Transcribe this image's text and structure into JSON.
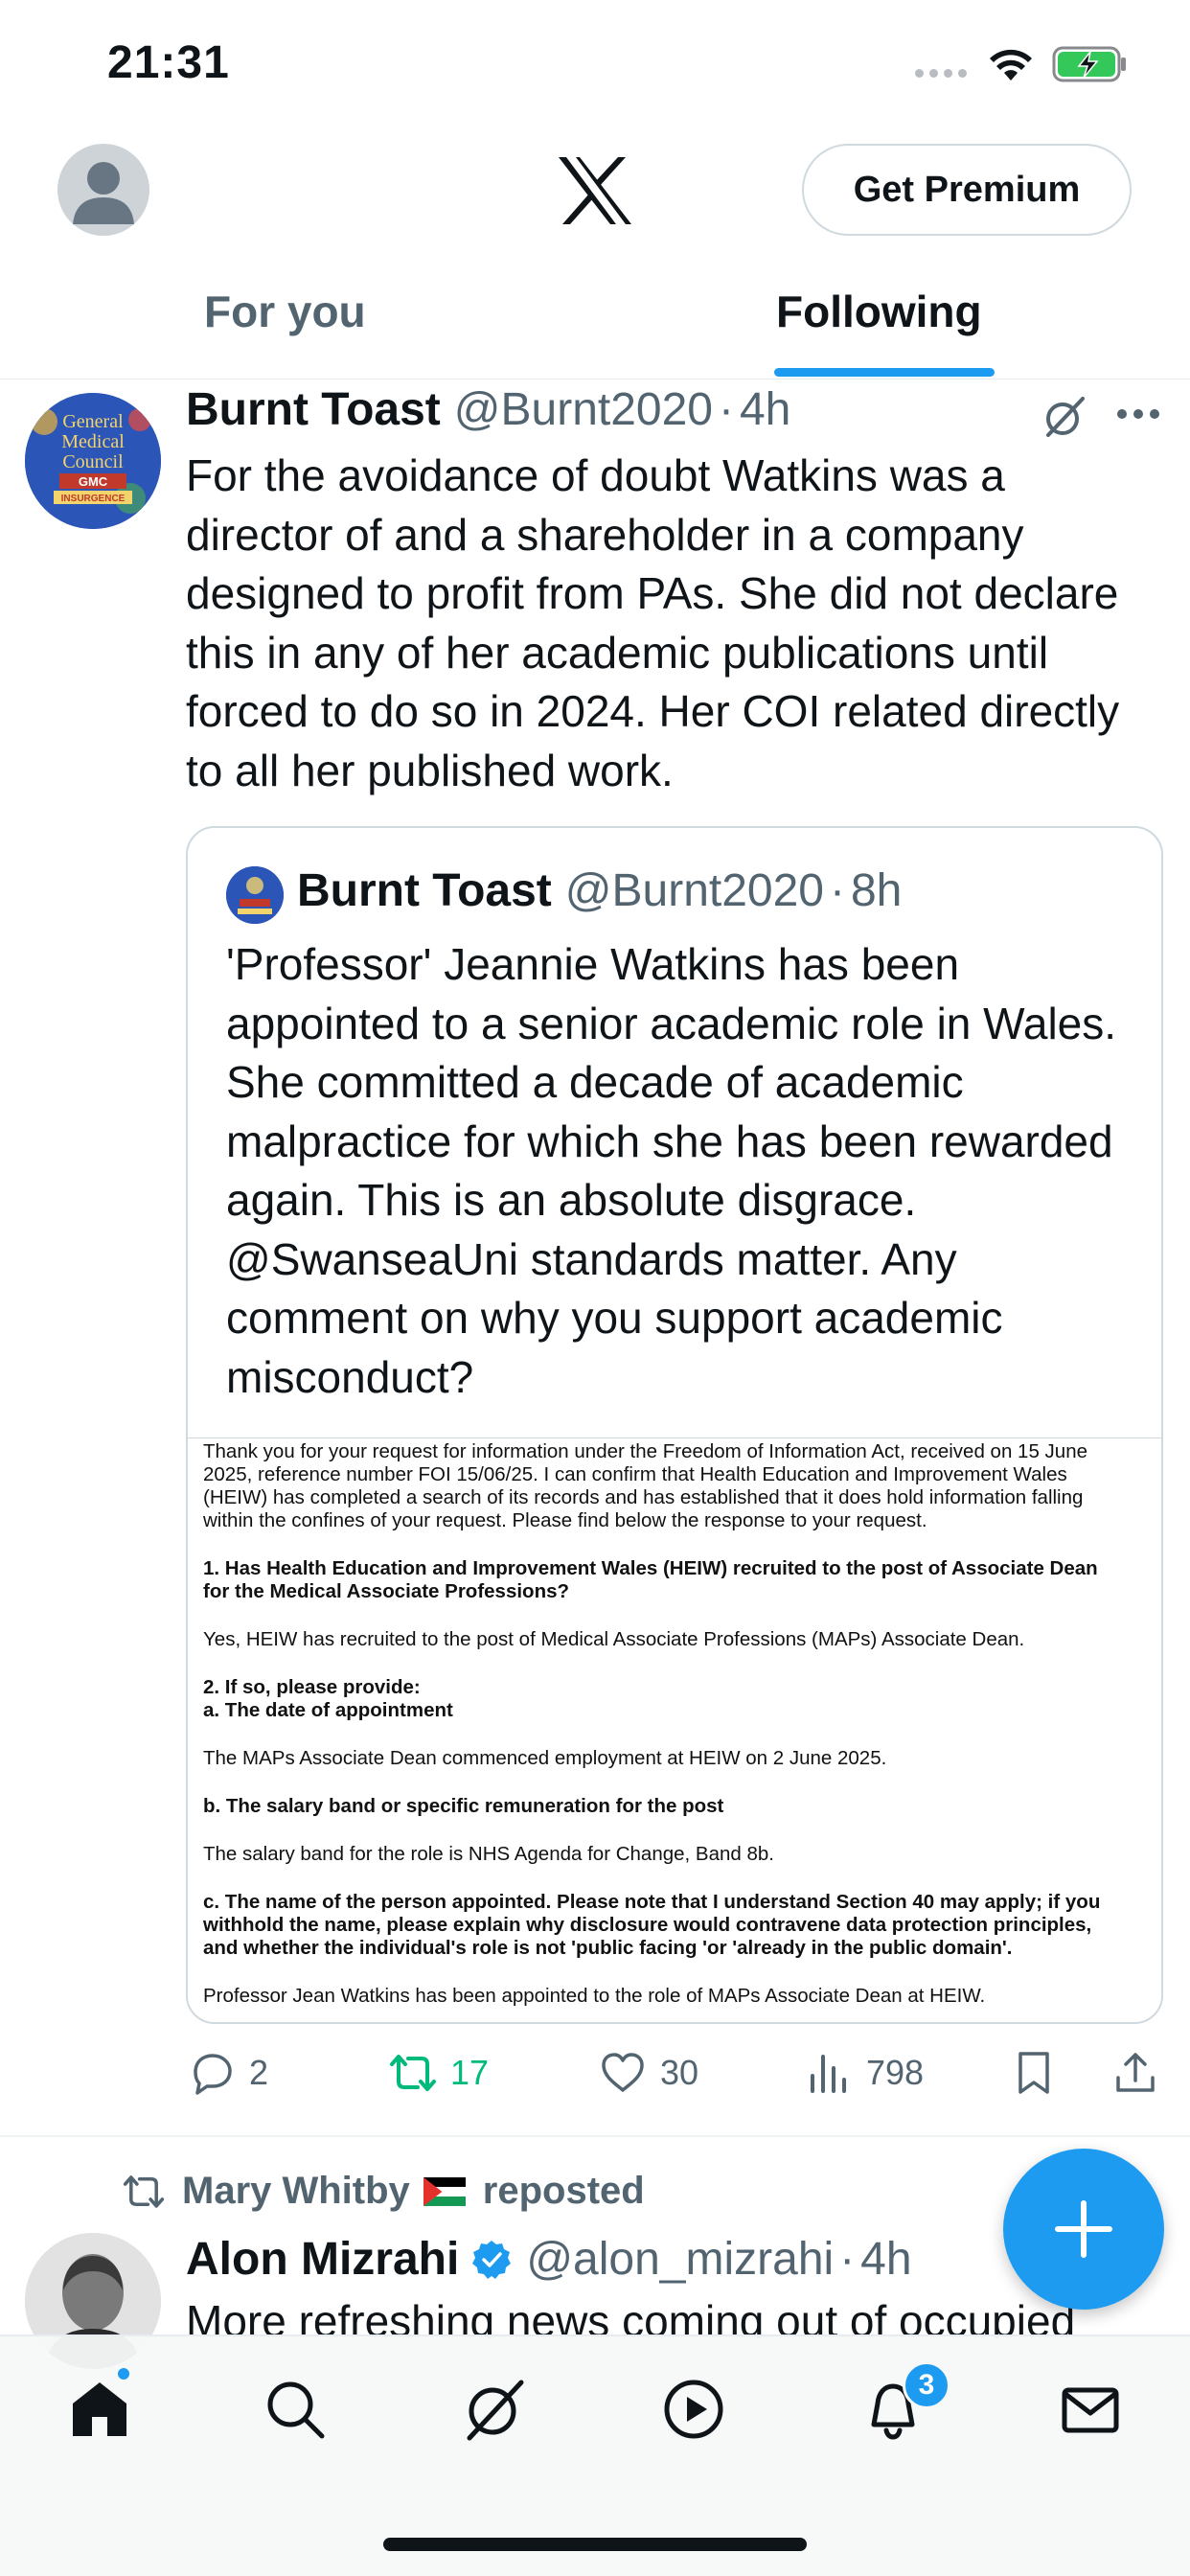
{
  "status_bar": {
    "time": "21:31"
  },
  "header": {
    "premium_label": "Get Premium"
  },
  "tabs": [
    {
      "label": "For you",
      "active": false
    },
    {
      "label": "Following",
      "active": true
    }
  ],
  "tweet1": {
    "name": "Burnt Toast",
    "handle": "@Burnt2020",
    "dot": "·",
    "time": "4h",
    "text": "For the avoidance of doubt Watkins was a director of and a shareholder in a company designed to profit from PAs. She did not declare this in any of her academic publications until forced to do so in 2024. Her COI related directly to all her published work.",
    "avatar_text": [
      "General",
      "Medical",
      "Council",
      "GMC",
      "INSURGENCE"
    ],
    "quote": {
      "name": "Burnt Toast",
      "handle": "@Burnt2020",
      "dot": "·",
      "time": "8h",
      "text": "'Professor' Jeannie Watkins has been appointed to a senior academic role in Wales. She committed a decade of academic malpractice for which she has been rewarded again. This is an absolute disgrace. @SwanseaUni standards matter. Any comment on why you support academic misconduct?",
      "document_lines": {
        "p1": [
          "Thank you for your request for information under the Freedom of Information Act, received on 15 June",
          "2025, reference number FOI 15/06/25. I can confirm that Health Education and Improvement Wales",
          "(HEIW) has completed a search of its records and has established that it does hold information falling",
          "within the confines of your request.  Please find below the response to your request."
        ],
        "q1": [
          "1. Has Health Education and Improvement Wales (HEIW) recruited to the post of Associate Dean",
          "for the Medical Associate Professions?"
        ],
        "a1": "Yes, HEIW has recruited to the post of Medical Associate Professions (MAPs) Associate Dean.",
        "q2": [
          "2. If so, please provide:",
          "a. The date of appointment"
        ],
        "a2": "The MAPs Associate Dean commenced employment at HEIW on 2 June 2025.",
        "q3": "b. The salary band or specific remuneration for the post",
        "a3": "The salary band for the role is NHS Agenda for Change, Band 8b.",
        "q4": [
          "c. The name of the person appointed. Please note that I understand Section 40 may apply; if you",
          "withhold the name, please explain why disclosure would contravene data protection principles,",
          "and whether the individual's role is not 'public facing 'or 'already in the public domain'."
        ],
        "a4": "Professor Jean Watkins has been appointed to the role of MAPs Associate Dean at HEIW."
      }
    },
    "stats": {
      "replies": "2",
      "reposts": "17",
      "likes": "30",
      "views": "798"
    }
  },
  "tweet2": {
    "reposted_by": "Mary Whitby",
    "reposted_label": "reposted",
    "name": "Alon Mizrahi",
    "handle": "@alon_mizrahi",
    "dot": "·",
    "time": "4h",
    "text": "More refreshing news coming out of occupied"
  },
  "bottom_nav": {
    "notifications_badge": "3"
  },
  "colors": {
    "accent": "#1d9bf0",
    "repost_green": "#00ba7c",
    "secondary_text": "#536471"
  },
  "icons": [
    "avatar",
    "x-logo",
    "grok-icon",
    "more-icon",
    "reply-icon",
    "repost-icon",
    "like-icon",
    "views-icon",
    "bookmark-icon",
    "share-icon",
    "verified-icon",
    "compose-icon",
    "home-icon",
    "search-icon",
    "grok-nav-icon",
    "video-icon",
    "notifications-icon",
    "messages-icon"
  ]
}
